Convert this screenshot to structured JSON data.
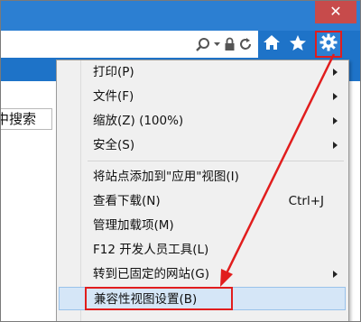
{
  "window": {
    "close_symbol": "✕"
  },
  "search_result_text": "中搜索",
  "menu": {
    "items": [
      {
        "label": "打印(P)",
        "has_submenu": true
      },
      {
        "label": "文件(F)",
        "has_submenu": true
      },
      {
        "label": "缩放(Z) (100%)",
        "has_submenu": true
      },
      {
        "label": "安全(S)",
        "has_submenu": true
      },
      {
        "label": "将站点添加到\"应用\"视图(I)"
      },
      {
        "label": "查看下载(N)",
        "shortcut": "Ctrl+J"
      },
      {
        "label": "管理加载项(M)"
      },
      {
        "label": "F12 开发人员工具(L)"
      },
      {
        "label": "转到已固定的网站(G)",
        "has_submenu": true
      },
      {
        "label": "兼容性视图设置(B)",
        "highlighted": true
      }
    ]
  },
  "icons": [
    "search-icon",
    "dropdown-icon",
    "lock-icon",
    "refresh-icon",
    "home-icon",
    "favorites-star-icon",
    "gear-icon"
  ],
  "colors": {
    "accent_blue": "#1e73c8",
    "annotation_red": "#e11d1d",
    "close_red": "#c74b4b",
    "highlight": "#d5e6f7"
  }
}
